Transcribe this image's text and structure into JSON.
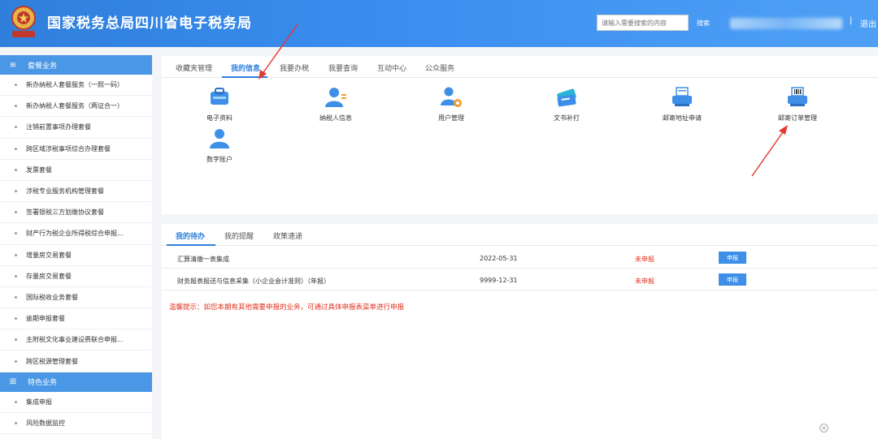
{
  "header": {
    "title": "国家税务总局四川省电子税务局",
    "search_placeholder": "请输入需要搜索的内容",
    "search_label": "搜索",
    "separator": "|",
    "logout_label": "退出"
  },
  "sidebar": {
    "groups": [
      {
        "label": "套餐业务",
        "items": [
          "新办纳税人套餐服务（一照一码）",
          "新办纳税人套餐服务（两证合一）",
          "注销前置事项办理套餐",
          "跨区域涉税事项综合办理套餐",
          "发票套餐",
          "涉税专业服务机构管理套餐",
          "签署银税三方划缴协议套餐",
          "财产行为税企业所得税综合申报...",
          "增量房交易套餐",
          "存量房交易套餐",
          "国际税收业务套餐",
          "逾期申报套餐",
          "主附税文化事业建设费联合申报...",
          "跨区税源管理套餐"
        ]
      },
      {
        "label": "特色业务",
        "items": [
          "集成申报",
          "风险数据监控"
        ]
      }
    ]
  },
  "main": {
    "tabs": [
      "收藏夹管理",
      "我的信息",
      "我要办税",
      "我要查询",
      "互动中心",
      "公众服务"
    ],
    "active_tab": "我的信息",
    "tiles": [
      "电子资料",
      "纳税人信息",
      "用户管理",
      "文书补打",
      "邮寄地址申请",
      "邮寄订单管理",
      "数字账户"
    ]
  },
  "todo": {
    "tabs": [
      "我的待办",
      "我的提醒",
      "政策速递"
    ],
    "active_tab": "我的待办",
    "rows": [
      {
        "name": "汇算清缴一表集成",
        "date": "2022-05-31",
        "status": "未申报",
        "action": "申报"
      },
      {
        "name": "财务报表报送与信息采集（小企业会计准则）（年报）",
        "date": "9999-12-31",
        "status": "未申报",
        "action": "申报"
      }
    ],
    "tip": "温馨提示：如您本期有其他需要申报的业务，可通过具体申报表菜单进行申报"
  },
  "colors": {
    "primary": "#2f7fdb",
    "header_end": "#4ea0f5",
    "sidebar_group": "#4a97e6",
    "alert": "#e0321e",
    "arrow": "#e53935"
  }
}
